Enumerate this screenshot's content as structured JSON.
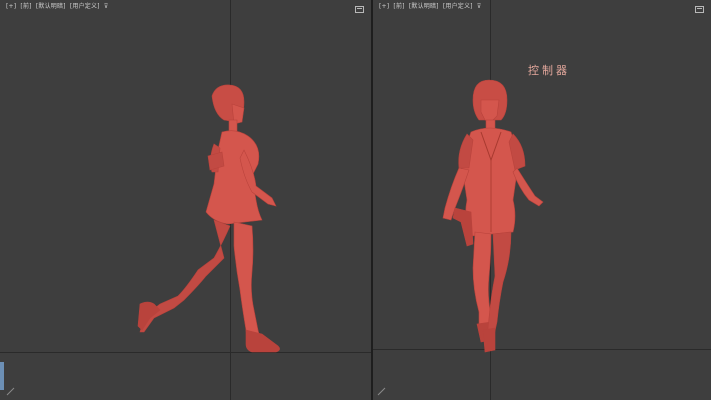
{
  "left_viewport": {
    "labels": [
      "[+]",
      "[前]",
      "[默认明暗]",
      "[用户定义]",
      "⊽"
    ]
  },
  "right_viewport": {
    "labels": [
      "[+]",
      "[前]",
      "[默认明暗]",
      "[用户定义]",
      "⊽"
    ],
    "caption": "控制器"
  },
  "colors": {
    "viewport_bg": "#3e3e3e",
    "model": "#d4564d"
  }
}
